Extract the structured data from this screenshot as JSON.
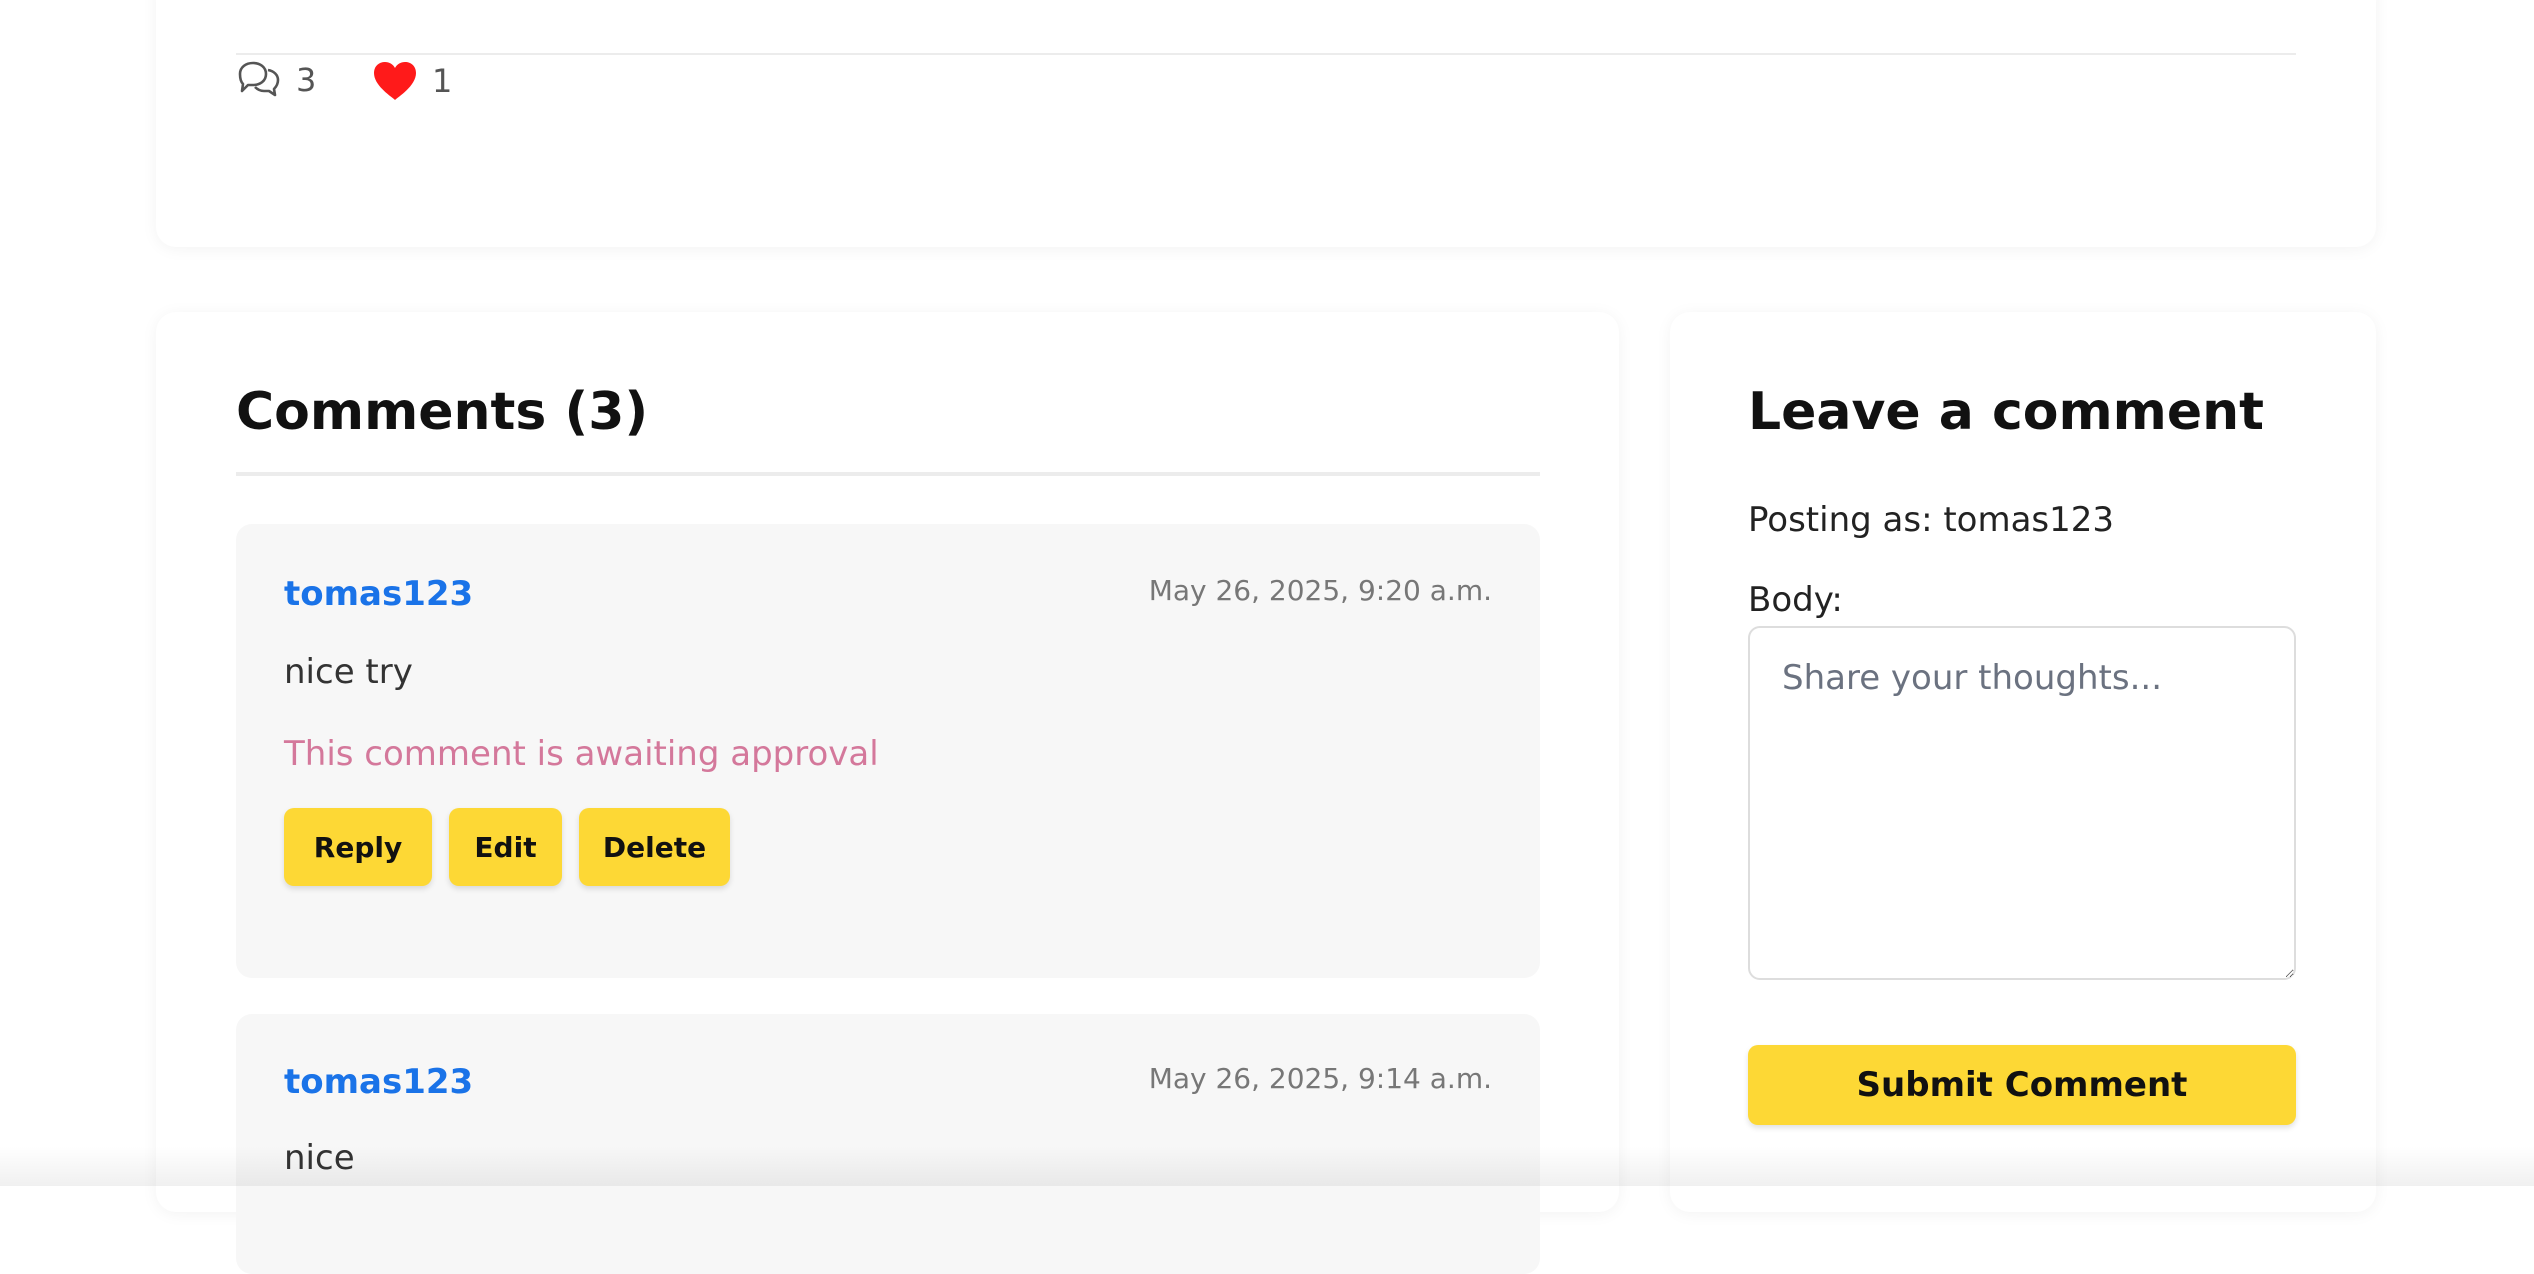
{
  "post": {
    "comment_count": "3",
    "like_count": "1"
  },
  "comments_section": {
    "title": "Comments (3)",
    "comments": [
      {
        "author": "tomas123",
        "date": "May 26, 2025, 9:20 a.m.",
        "body": "nice try",
        "status": "This comment is awaiting approval",
        "actions": {
          "reply": "Reply",
          "edit": "Edit",
          "delete": "Delete"
        }
      },
      {
        "author": "tomas123",
        "date": "May 26, 2025, 9:14 a.m.",
        "body": "nice"
      }
    ]
  },
  "comment_form": {
    "title": "Leave a comment",
    "posting_as": "Posting as: tomas123",
    "body_label": "Body:",
    "body_placeholder": "Share your thoughts...",
    "submit_label": "Submit Comment"
  },
  "colors": {
    "accent": "#fdd835",
    "author_link": "#1a73e8",
    "pending_status": "#d4789b",
    "heart": "#ff1a1a"
  },
  "icons": {
    "comments": "speech-bubbles-icon",
    "likes": "heart-icon"
  }
}
